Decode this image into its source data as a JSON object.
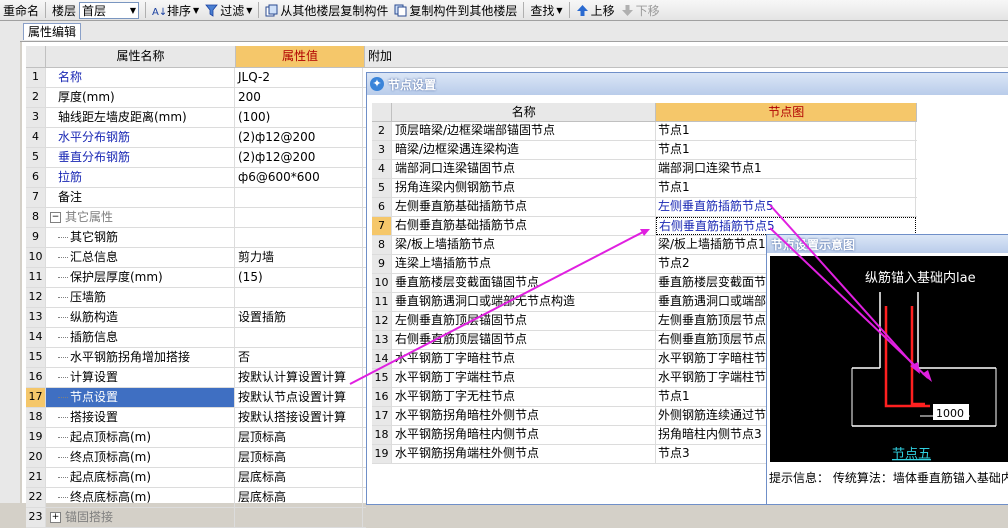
{
  "toolbar": {
    "rename": "重命名",
    "floor_label": "楼层",
    "floor_value": "首层",
    "sort": "排序",
    "filter": "过滤",
    "copy_from": "从其他楼层复制构件",
    "copy_to": "复制构件到其他楼层",
    "find": "查找",
    "move_up": "上移",
    "move_down": "下移"
  },
  "tab": {
    "label": "属性编辑"
  },
  "grid": {
    "col_name": "属性名称",
    "col_value": "属性值",
    "extra_header": "附加",
    "rows": [
      {
        "idx": "1",
        "name": "名称",
        "value": "JLQ-2",
        "style": "blue"
      },
      {
        "idx": "2",
        "name": "厚度(mm)",
        "value": "200",
        "style": ""
      },
      {
        "idx": "3",
        "name": "轴线距左墙皮距离(mm)",
        "value": "(100)",
        "style": ""
      },
      {
        "idx": "4",
        "name": "水平分布钢筋",
        "value": "(2)ф12@200",
        "style": "blue"
      },
      {
        "idx": "5",
        "name": "垂直分布钢筋",
        "value": "(2)ф12@200",
        "style": "blue"
      },
      {
        "idx": "6",
        "name": "拉筋",
        "value": "ф6@600*600",
        "style": "blue"
      },
      {
        "idx": "7",
        "name": "备注",
        "value": "",
        "style": ""
      },
      {
        "idx": "8",
        "name": "其它属性",
        "value": "",
        "style": "group",
        "expander": "−"
      },
      {
        "idx": "9",
        "name": "其它钢筋",
        "value": "",
        "style": "child"
      },
      {
        "idx": "10",
        "name": "汇总信息",
        "value": "剪力墙",
        "style": "child"
      },
      {
        "idx": "11",
        "name": "保护层厚度(mm)",
        "value": "(15)",
        "style": "child"
      },
      {
        "idx": "12",
        "name": "压墙筋",
        "value": "",
        "style": "child"
      },
      {
        "idx": "13",
        "name": "纵筋构造",
        "value": "设置插筋",
        "style": "child"
      },
      {
        "idx": "14",
        "name": "插筋信息",
        "value": "",
        "style": "child"
      },
      {
        "idx": "15",
        "name": "水平钢筋拐角增加搭接",
        "value": "否",
        "style": "child"
      },
      {
        "idx": "16",
        "name": "计算设置",
        "value": "按默认计算设置计算",
        "style": "child"
      },
      {
        "idx": "17",
        "name": "节点设置",
        "value": "按默认节点设置计算",
        "style": "child",
        "selected": true
      },
      {
        "idx": "18",
        "name": "搭接设置",
        "value": "按默认搭接设置计算",
        "style": "child"
      },
      {
        "idx": "19",
        "name": "起点顶标高(m)",
        "value": "层顶标高",
        "style": "child"
      },
      {
        "idx": "20",
        "name": "终点顶标高(m)",
        "value": "层顶标高",
        "style": "child"
      },
      {
        "idx": "21",
        "name": "起点底标高(m)",
        "value": "层底标高",
        "style": "child"
      },
      {
        "idx": "22",
        "name": "终点底标高(m)",
        "value": "层底标高",
        "style": "child"
      },
      {
        "idx": "23",
        "name": "锚固搭接",
        "value": "",
        "style": "group",
        "expander": "+"
      }
    ]
  },
  "dialog": {
    "title": "节点设置",
    "col_name": "名称",
    "col_node": "节点图",
    "rows": [
      {
        "idx": "2",
        "name": "顶层暗梁/边框梁端部锚固节点",
        "node": "节点1"
      },
      {
        "idx": "3",
        "name": "暗梁/边框梁遇连梁构造",
        "node": "节点1"
      },
      {
        "idx": "4",
        "name": "端部洞口连梁锚固节点",
        "node": "端部洞口连梁节点1"
      },
      {
        "idx": "5",
        "name": "拐角连梁内侧钢筋节点",
        "node": "节点1"
      },
      {
        "idx": "6",
        "name": "左侧垂直筋基础插筋节点",
        "node": "左侧垂直筋插筋节点5",
        "link": true
      },
      {
        "idx": "7",
        "name": "右侧垂直筋基础插筋节点",
        "node": "右侧垂直筋插筋节点5",
        "link": true,
        "selected": true
      },
      {
        "idx": "8",
        "name": "梁/板上墙插筋节点",
        "node": "梁/板上墙插筋节点1"
      },
      {
        "idx": "9",
        "name": "连梁上墙插筋节点",
        "node": "节点2"
      },
      {
        "idx": "10",
        "name": "垂直筋楼层变截面锚固节点",
        "node": "垂直筋楼层变截面节"
      },
      {
        "idx": "11",
        "name": "垂直钢筋遇洞口或端部无节点构造",
        "node": "垂直筋遇洞口或端部"
      },
      {
        "idx": "12",
        "name": "左侧垂直筋顶层锚固节点",
        "node": "左侧垂直筋顶层节点"
      },
      {
        "idx": "13",
        "name": "右侧垂直筋顶层锚固节点",
        "node": "右侧垂直筋顶层节点"
      },
      {
        "idx": "14",
        "name": "水平钢筋丁字暗柱节点",
        "node": "水平钢筋丁字暗柱节"
      },
      {
        "idx": "15",
        "name": "水平钢筋丁字端柱节点",
        "node": "水平钢筋丁字端柱节"
      },
      {
        "idx": "16",
        "name": "水平钢筋丁字无柱节点",
        "node": "节点1"
      },
      {
        "idx": "17",
        "name": "水平钢筋拐角暗柱外侧节点",
        "node": "外侧钢筋连续通过节"
      },
      {
        "idx": "18",
        "name": "水平钢筋拐角暗柱内侧节点",
        "node": "拐角暗柱内侧节点3"
      },
      {
        "idx": "19",
        "name": "水平钢筋拐角端柱外侧节点",
        "node": "节点3"
      }
    ]
  },
  "preview": {
    "title": "节点设置示意图",
    "heading": "纵筋锚入基础内lae",
    "dim_value": "1000",
    "node_label": "节点五",
    "tip": "提示信息：  传统算法：墙体垂直筋锚入基础内"
  },
  "colors": {
    "value_header": "#f5c76a",
    "selection": "#3f6fc2",
    "arrow": "#e020e0",
    "rebar": "#ff2020"
  }
}
